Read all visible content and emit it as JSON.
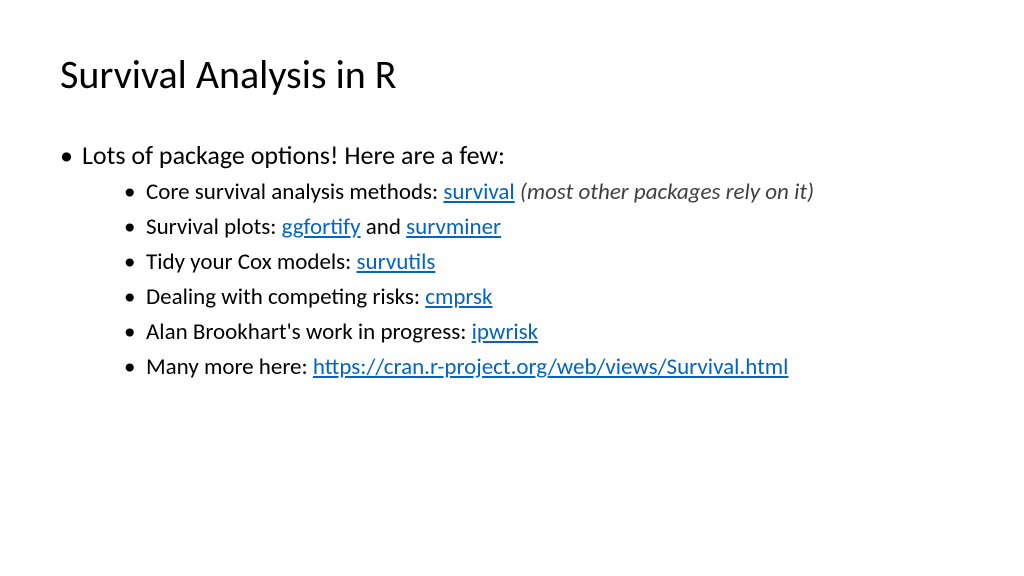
{
  "title": "Survival Analysis in R",
  "main_bullet": "Lots of package options! Here are a few:",
  "items": [
    {
      "prefix": "Core survival analysis methods: ",
      "link1": "survival",
      "mid": "   ",
      "note": "(most other packages rely on it)"
    },
    {
      "prefix": "Survival plots: ",
      "link1": "ggfortify",
      "mid": " and ",
      "link2": "survminer"
    },
    {
      "prefix": "Tidy your Cox models: ",
      "link1": "survutils"
    },
    {
      "prefix": "Dealing with competing risks: ",
      "link1": "cmprsk"
    },
    {
      "prefix": "Alan Brookhart's work in progress: ",
      "link1": "ipwrisk"
    },
    {
      "prefix": "Many more here: ",
      "link1": "https://cran.r-project.org/web/views/Survival.html"
    }
  ]
}
